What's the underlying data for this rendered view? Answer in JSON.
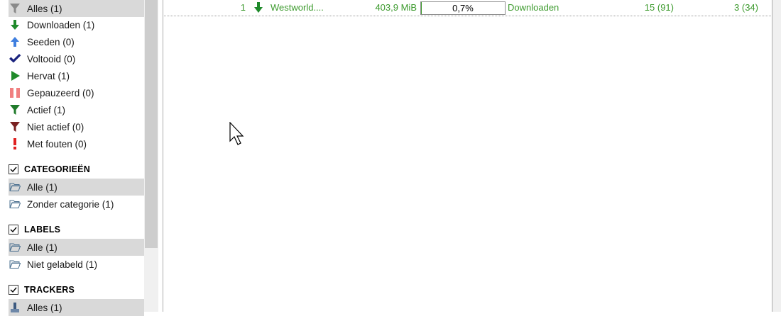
{
  "status_filters": [
    {
      "label": "Alles (1)",
      "icon": "filter-icon",
      "selected": true
    },
    {
      "label": "Downloaden (1)",
      "icon": "download-arrow-icon",
      "selected": false
    },
    {
      "label": "Seeden (0)",
      "icon": "upload-arrow-icon",
      "selected": false
    },
    {
      "label": "Voltooid (0)",
      "icon": "checkmark-icon",
      "selected": false
    },
    {
      "label": "Hervat (1)",
      "icon": "play-icon",
      "selected": false
    },
    {
      "label": "Gepauzeerd (0)",
      "icon": "pause-icon",
      "selected": false
    },
    {
      "label": "Actief (1)",
      "icon": "active-filter-icon",
      "selected": false
    },
    {
      "label": "Niet actief (0)",
      "icon": "inactive-filter-icon",
      "selected": false
    },
    {
      "label": "Met fouten (0)",
      "icon": "error-exclamation-icon",
      "selected": false
    }
  ],
  "categories": {
    "header": "CATEGORIEËN",
    "items": [
      {
        "label": "Alle (1)",
        "icon": "folder-icon",
        "selected": true
      },
      {
        "label": "Zonder categorie (1)",
        "icon": "folder-icon",
        "selected": false
      }
    ]
  },
  "labels": {
    "header": "LABELS",
    "items": [
      {
        "label": "Alle (1)",
        "icon": "folder-icon",
        "selected": true
      },
      {
        "label": "Niet gelabeld (1)",
        "icon": "folder-icon",
        "selected": false
      }
    ]
  },
  "trackers": {
    "header": "TRACKERS",
    "items": [
      {
        "label": "Alles (1)",
        "icon": "tracker-icon",
        "selected": true
      }
    ]
  },
  "torrent": {
    "index": "1",
    "name": "Westworld....",
    "size": "403,9 MiB",
    "progress_text": "0,7%",
    "progress_fraction": 0.007,
    "status": "Downloaden",
    "seeds": "15 (91)",
    "peers": "3 (34)",
    "status_color": "#3c9a2d"
  }
}
